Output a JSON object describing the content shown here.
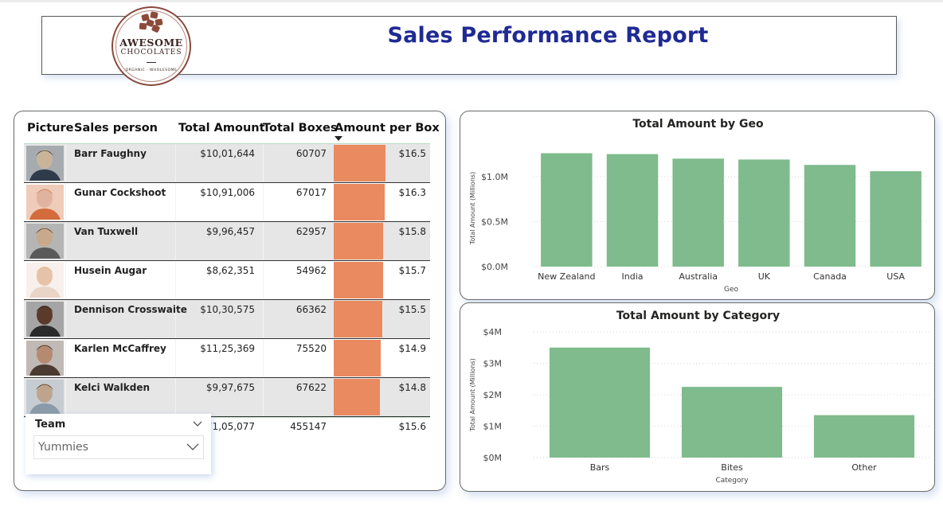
{
  "header": {
    "title": "Sales Performance Report"
  },
  "logo": {
    "name": "AWESOME",
    "sub": "CHOCOLATES",
    "tagline": "ORGANIC · WHOLESOME"
  },
  "table": {
    "columns": [
      "Picture",
      "Sales person",
      "Total Amount",
      "Total Boxes",
      "Amount per Box"
    ],
    "rows": [
      {
        "name": "Barr Faughny",
        "amount": "$10,01,644",
        "boxes": "60707",
        "apb": "$16.5",
        "apb_value": 16.5
      },
      {
        "name": "Gunar Cockshoot",
        "amount": "$10,91,006",
        "boxes": "67017",
        "apb": "$16.3",
        "apb_value": 16.3
      },
      {
        "name": "Van Tuxwell",
        "amount": "$9,96,457",
        "boxes": "62957",
        "apb": "$15.8",
        "apb_value": 15.8
      },
      {
        "name": "Husein Augar",
        "amount": "$8,62,351",
        "boxes": "54962",
        "apb": "$15.7",
        "apb_value": 15.7
      },
      {
        "name": "Dennison Crosswaite",
        "amount": "$10,30,575",
        "boxes": "66362",
        "apb": "$15.5",
        "apb_value": 15.5
      },
      {
        "name": "Karlen McCaffrey",
        "amount": "$11,25,369",
        "boxes": "75520",
        "apb": "$14.9",
        "apb_value": 14.9
      },
      {
        "name": "Kelci Walkden",
        "amount": "$9,97,675",
        "boxes": "67622",
        "apb": "$14.8",
        "apb_value": 14.8
      }
    ],
    "totals": {
      "amount": "71,05,077",
      "boxes": "455147",
      "apb": "$15.6"
    },
    "bar_color": "#ea8a60"
  },
  "slicer": {
    "title": "Team",
    "value": "Yummies"
  },
  "chart_data": [
    {
      "type": "bar",
      "title": "Total Amount by Geo",
      "xlabel": "Geo",
      "ylabel": "Total Amount (Millions)",
      "categories": [
        "New Zealand",
        "India",
        "Australia",
        "UK",
        "Canada",
        "USA"
      ],
      "values": [
        1.26,
        1.25,
        1.2,
        1.19,
        1.13,
        1.06
      ],
      "ylim": [
        0,
        1.3
      ],
      "yticks": [
        0,
        0.5,
        1.0
      ],
      "ytick_labels": [
        "$0.0M",
        "$0.5M",
        "$1.0M"
      ],
      "color": "#7fbb8c",
      "grid": true
    },
    {
      "type": "bar",
      "title": "Total Amount by Category",
      "xlabel": "Category",
      "ylabel": "Total Amount (Millions)",
      "categories": [
        "Bars",
        "Bites",
        "Other"
      ],
      "values": [
        3.5,
        2.25,
        1.35
      ],
      "ylim": [
        0,
        4
      ],
      "yticks": [
        0,
        1,
        2,
        3,
        4
      ],
      "ytick_labels": [
        "$0M",
        "$1M",
        "$2M",
        "$3M",
        "$4M"
      ],
      "color": "#7fbb8c",
      "grid": true
    }
  ]
}
